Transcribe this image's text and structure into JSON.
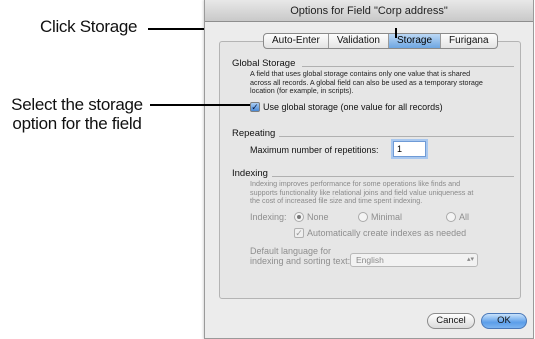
{
  "annotations": {
    "callout_1": "Click Storage",
    "callout_2_line1": "Select the storage",
    "callout_2_line2": "option for the field"
  },
  "dialog": {
    "title": "Options for Field \"Corp address\"",
    "tabs": [
      "Auto-Enter",
      "Validation",
      "Storage",
      "Furigana"
    ],
    "active_tab": "Storage"
  },
  "global_storage": {
    "title": "Global Storage",
    "description_1": "A field that uses global storage contains only one value that is shared",
    "description_2": "across all records.  A global field can also be used as a temporary storage",
    "description_3": "location (for example, in scripts).",
    "checkbox_label": "Use global storage (one value for all records)",
    "checked": true
  },
  "repeating": {
    "title": "Repeating",
    "label": "Maximum number of repetitions:",
    "value": "1"
  },
  "indexing": {
    "title": "Indexing",
    "description_1": "Indexing improves performance for some operations like finds and",
    "description_2": "supports functionality like relational joins and field value uniqueness at",
    "description_3": "the cost of increased file size and time spent indexing.",
    "indexing_label": "Indexing:",
    "options": [
      "None",
      "Minimal",
      "All"
    ],
    "selected_option": "None",
    "auto_label": "Automatically create indexes as needed",
    "lang_label_1": "Default language for",
    "lang_label_2": "indexing and sorting text:",
    "language": "English"
  },
  "buttons": {
    "cancel": "Cancel",
    "ok": "OK"
  },
  "colors": {
    "accent": "#5c9ee9",
    "window": "#ececec"
  }
}
